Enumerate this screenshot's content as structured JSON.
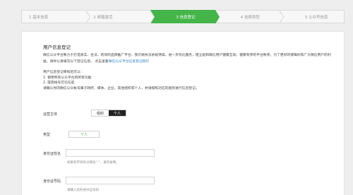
{
  "stepper": {
    "steps": [
      {
        "label": "1 基本信息"
      },
      {
        "label": "2 邮箱激活"
      },
      {
        "label": "3 信息登记"
      },
      {
        "label": "4 选择类型"
      },
      {
        "label": "5 公众号信息"
      }
    ],
    "active_index": 2
  },
  "main": {
    "title": "用户信息登记",
    "intro_text": "微信公众平台致力于打造真实、合法、有效的品牌推广平台，我们将依法依规持续、进一步优化服务，建立起和微信用户健康互动、健康有序的平台秩序。为了更好的保障你和广大微信用户的利益，请你认真填写以下登记信息。",
    "intro_link": "微信公众平台信息登记指引",
    "intro_link_prefix": "点击查看",
    "uses_title": "用户信息登记审核后可以：",
    "uses_items": [
      "1. 使用所有公众平台的所有功能",
      "2. 提高帐号可信任度"
    ],
    "uses_note": "请确认你的微信公众帐号属于政府、媒体、企业、其他组织或个人，并请按照对应的类别进行信息登记。"
  },
  "form": {
    "subject_label": "运营主体",
    "subject_options": [
      "组织",
      "个人"
    ],
    "subject_selected": "个人",
    "type_label": "类型",
    "type_value": "个人",
    "id_name_label": "身份证姓名",
    "id_name_hint": "如果有字母有分隔号“·”，请勿省略。",
    "id_number_label": "身份证号码",
    "id_number_hint": "请输入您的身份证号码"
  }
}
